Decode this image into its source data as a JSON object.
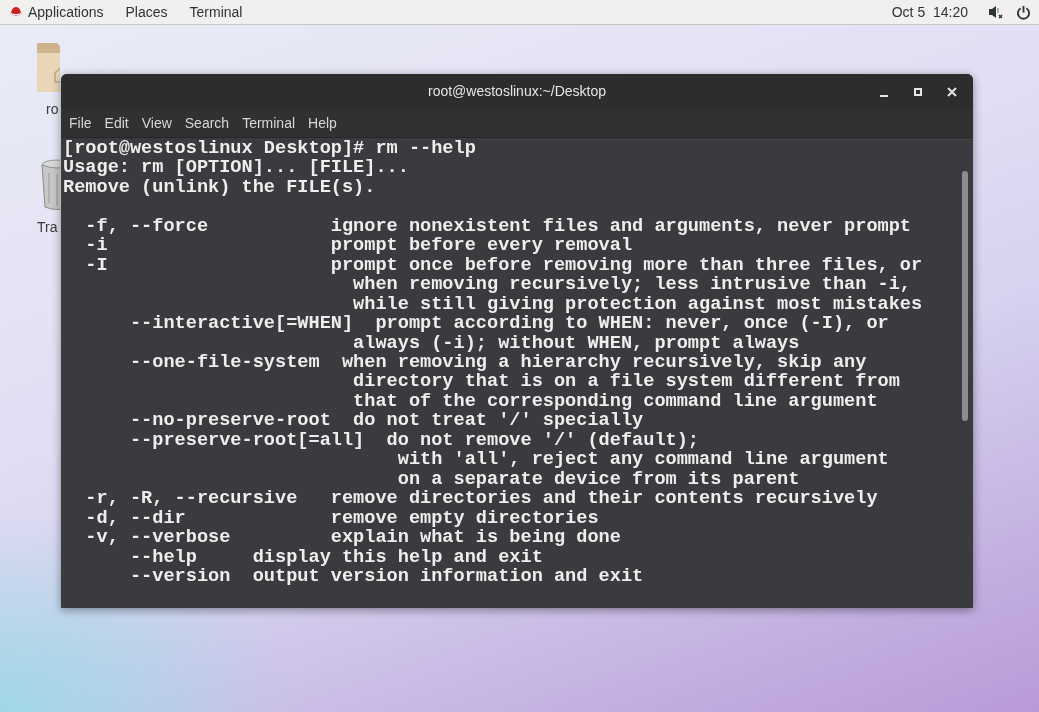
{
  "top_bar": {
    "menus": [
      "Applications",
      "Places",
      "Terminal"
    ],
    "clock": "Oct 5  14:20"
  },
  "desktop_icons": [
    {
      "kind": "folder",
      "label": "ro"
    },
    {
      "kind": "trash",
      "label": "Tra"
    }
  ],
  "terminal": {
    "title": "root@westoslinux:~/Desktop",
    "menu": [
      "File",
      "Edit",
      "View",
      "Search",
      "Terminal",
      "Help"
    ],
    "blocks": [
      [
        "[root@westoslinux Desktop]# rm --help",
        "Usage: rm [OPTION]... [FILE]...",
        "Remove (unlink) the FILE(s)."
      ],
      [
        "  -f, --force           ignore nonexistent files and arguments, never prompt",
        "  -i                    prompt before every removal",
        "  -I                    prompt once before removing more than three files, or",
        "                          when removing recursively; less intrusive than -i,",
        "                          while still giving protection against most mistakes",
        "      --interactive[=WHEN]  prompt according to WHEN: never, once (-I), or",
        "                          always (-i); without WHEN, prompt always",
        "      --one-file-system  when removing a hierarchy recursively, skip any",
        "                          directory that is on a file system different from",
        "                          that of the corresponding command line argument",
        "      --no-preserve-root  do not treat '/' specially",
        "      --preserve-root[=all]  do not remove '/' (default);",
        "                              with 'all', reject any command line argument",
        "                              on a separate device from its parent",
        "  -r, -R, --recursive   remove directories and their contents recursively",
        "  -d, --dir             remove empty directories",
        "  -v, --verbose         explain what is being done",
        "      --help     display this help and exit",
        "      --version  output version information and exit"
      ]
    ]
  }
}
